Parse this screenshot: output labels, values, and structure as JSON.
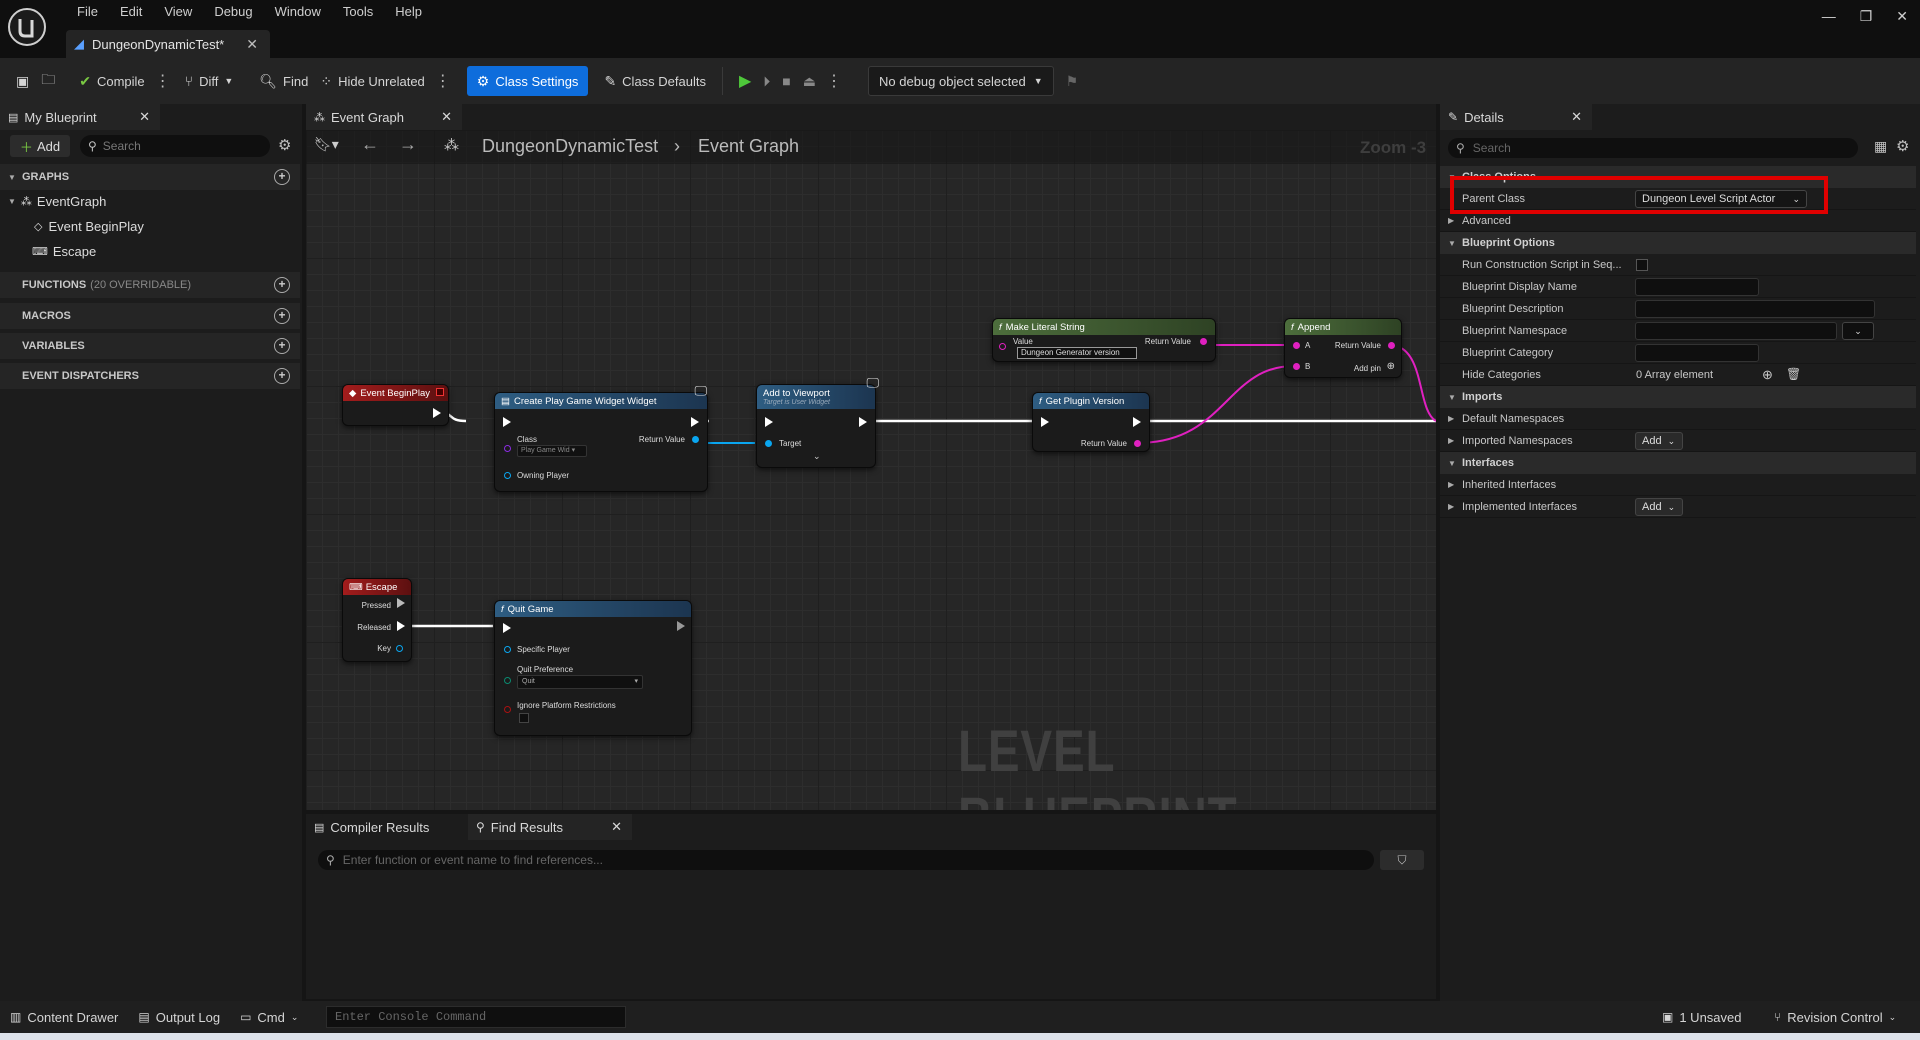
{
  "app": {
    "menu": [
      "File",
      "Edit",
      "View",
      "Debug",
      "Window",
      "Tools",
      "Help"
    ],
    "document_tab": "DungeonDynamicTest*"
  },
  "toolbar": {
    "compile": "Compile",
    "diff": "Diff",
    "find": "Find",
    "hide_unrelated": "Hide Unrelated",
    "class_settings": "Class Settings",
    "class_defaults": "Class Defaults",
    "debug_object": "No debug object selected"
  },
  "my_blueprint": {
    "tab": "My Blueprint",
    "add": "Add",
    "search_placeholder": "Search",
    "graphs_header": "GRAPHS",
    "event_graph": "EventGraph",
    "events": [
      "Event BeginPlay",
      "Escape"
    ],
    "functions_header": "FUNCTIONS",
    "functions_count": "(20 OVERRIDABLE)",
    "macros_header": "MACROS",
    "variables_header": "VARIABLES",
    "dispatchers_header": "EVENT DISPATCHERS"
  },
  "graph": {
    "tab": "Event Graph",
    "breadcrumb_root": "DungeonDynamicTest",
    "breadcrumb_leaf": "Event Graph",
    "zoom": "Zoom -3",
    "watermark": "LEVEL BLUEPRINT",
    "nodes": {
      "begin_play": "Event BeginPlay",
      "create_widget": "Create Play Game Widget Widget",
      "create_widget_class_label": "Class",
      "create_widget_class_value": "Play Game Wid",
      "create_widget_return": "Return Value",
      "create_widget_owning": "Owning Player",
      "add_viewport": "Add to Viewport",
      "add_viewport_sub": "Target is User Widget",
      "add_viewport_target": "Target",
      "make_literal": "Make Literal String",
      "make_literal_value_label": "Value",
      "make_literal_value": "Dungeon Generator version",
      "make_literal_return": "Return Value",
      "append": "Append",
      "append_a": "A",
      "append_b": "B",
      "append_return": "Return Value",
      "append_add_pin": "Add pin",
      "plugin_version": "Get Plugin Version",
      "plugin_version_return": "Return Value",
      "escape": "Escape",
      "escape_pressed": "Pressed",
      "escape_released": "Released",
      "escape_key": "Key",
      "quit": "Quit Game",
      "quit_player": "Specific Player",
      "quit_pref_label": "Quit Preference",
      "quit_pref_value": "Quit",
      "quit_ignore": "Ignore Platform Restrictions"
    }
  },
  "bottom_tabs": {
    "compiler": "Compiler Results",
    "find": "Find Results",
    "find_placeholder": "Enter function or event name to find references..."
  },
  "details": {
    "tab": "Details",
    "search_placeholder": "Search",
    "class_options": "Class Options",
    "parent_class_label": "Parent Class",
    "parent_class_value": "Dungeon Level Script Actor",
    "advanced": "Advanced",
    "blueprint_options": "Blueprint Options",
    "run_construction": "Run Construction Script in Seq...",
    "display_name": "Blueprint Display Name",
    "description": "Blueprint Description",
    "namespace": "Blueprint Namespace",
    "category": "Blueprint Category",
    "hide_categories": "Hide Categories",
    "hide_categories_value": "0 Array element",
    "imports": "Imports",
    "default_namespaces": "Default Namespaces",
    "imported_namespaces": "Imported Namespaces",
    "interfaces": "Interfaces",
    "inherited_interfaces": "Inherited Interfaces",
    "implemented_interfaces": "Implemented Interfaces",
    "add": "Add"
  },
  "statusbar": {
    "content_drawer": "Content Drawer",
    "output_log": "Output Log",
    "cmd": "Cmd",
    "console_placeholder": "Enter Console Command",
    "unsaved": "1 Unsaved",
    "revision_control": "Revision Control"
  },
  "colors": {
    "accent": "#0e6ddc",
    "highlight": "#e00000",
    "event_node": "#8c1818",
    "function_node": "#2e5d82",
    "pure_node": "#4d6e3c",
    "string_wire": "#e020c0",
    "object_wire": "#0aa6f0"
  }
}
